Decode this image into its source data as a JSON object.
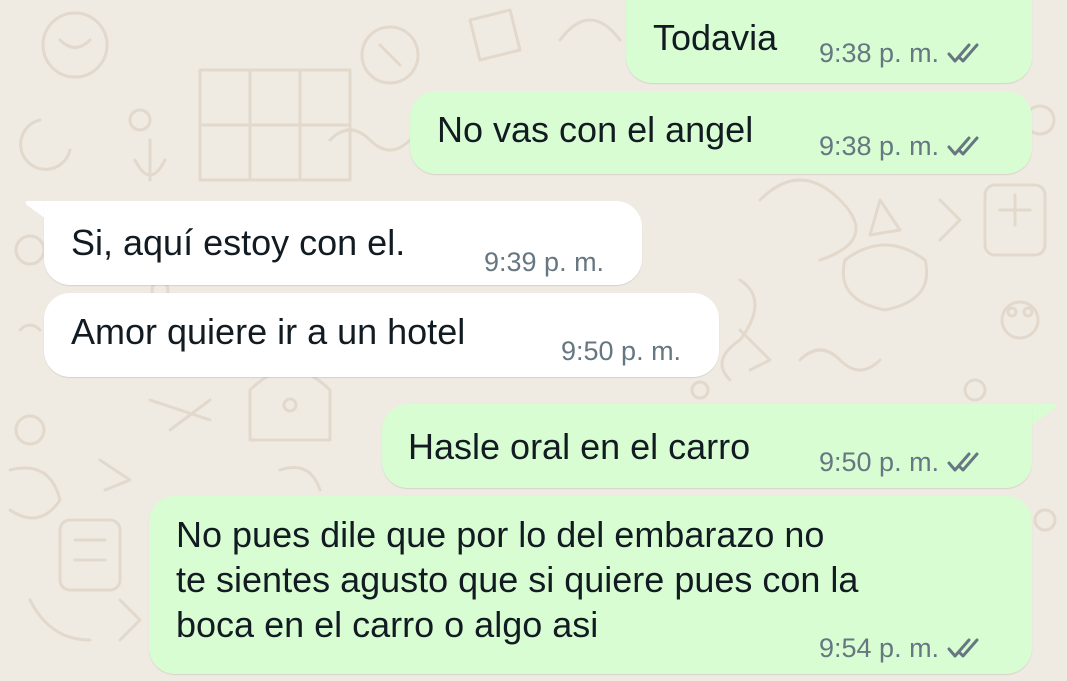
{
  "chat": {
    "messages": [
      {
        "direction": "outgoing",
        "text": "Todavia",
        "time": "9:38 p. m.",
        "status_icon": "double-check-icon"
      },
      {
        "direction": "outgoing",
        "text": "No vas con el angel",
        "time": "9:38 p. m.",
        "status_icon": "double-check-icon"
      },
      {
        "direction": "incoming",
        "text": "Si, aquí estoy con el.",
        "time": "9:39 p. m."
      },
      {
        "direction": "incoming",
        "text": "Amor quiere ir a un hotel",
        "time": "9:50 p. m."
      },
      {
        "direction": "outgoing",
        "text": "Hasle oral en el carro",
        "time": "9:50 p. m.",
        "status_icon": "double-check-icon"
      },
      {
        "direction": "outgoing",
        "text": "No pues dile que por lo del embarazo no\nte sientes agusto que si quiere pues con la\nboca en el carro o algo asi",
        "time": "9:54 p. m.",
        "status_icon": "double-check-icon"
      }
    ]
  },
  "colors": {
    "background": "#efeae2",
    "outgoing_bubble": "#d9fdd3",
    "incoming_bubble": "#ffffff",
    "text": "#111b21",
    "meta": "#667781"
  }
}
